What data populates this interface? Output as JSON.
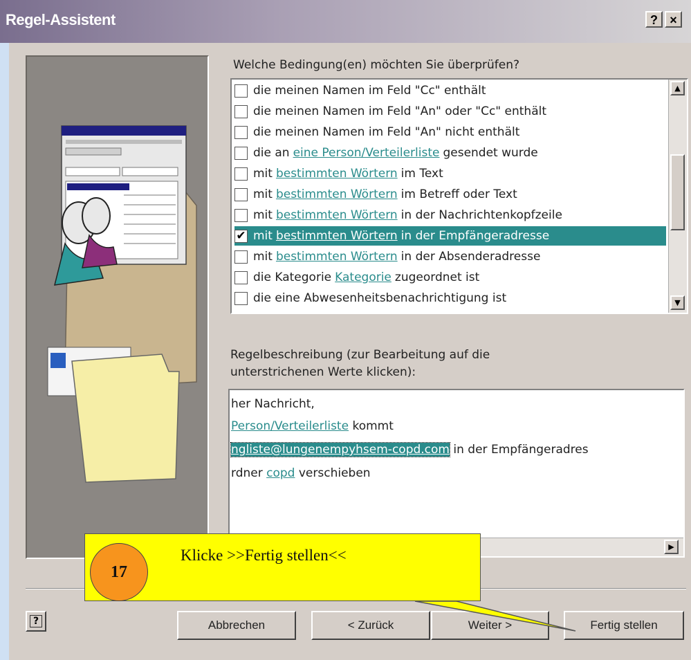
{
  "window": {
    "title": "Regel-Assistent",
    "help_btn": "?",
    "close_btn": "×"
  },
  "conditions": {
    "heading": "Welche Bedingung(en) möchten Sie überprüfen?",
    "items": [
      {
        "checked": false,
        "before": "die meinen Namen im Feld \"Cc\" enthält",
        "link": "",
        "after": ""
      },
      {
        "checked": false,
        "before": "die meinen Namen im Feld \"An\" oder \"Cc\" enthält",
        "link": "",
        "after": ""
      },
      {
        "checked": false,
        "before": "die meinen Namen im Feld \"An\" nicht enthält",
        "link": "",
        "after": ""
      },
      {
        "checked": false,
        "before": "die an",
        "link": "eine Person/Verteilerliste",
        "after": "gesendet wurde"
      },
      {
        "checked": false,
        "before": "mit",
        "link": "bestimmten Wörtern",
        "after": "im Text"
      },
      {
        "checked": false,
        "before": "mit",
        "link": "bestimmten Wörtern",
        "after": "im Betreff oder Text"
      },
      {
        "checked": false,
        "before": "mit",
        "link": "bestimmten Wörtern",
        "after": "in der Nachrichtenkopfzeile"
      },
      {
        "checked": true,
        "before": "mit",
        "link": "bestimmten Wörtern",
        "after": "in der Empfängeradresse"
      },
      {
        "checked": false,
        "before": "mit",
        "link": "bestimmten Wörtern",
        "after": "in der Absenderadresse"
      },
      {
        "checked": false,
        "before": "die Kategorie",
        "link": "Kategorie",
        "after": "zugeordnet ist"
      },
      {
        "checked": false,
        "before": "die eine Abwesenheitsbenachrichtigung ist",
        "link": "",
        "after": ""
      }
    ]
  },
  "description": {
    "heading_line1": "Regelbeschreibung (zur Bearbeitung auf die",
    "heading_line2": "unterstrichenen Werte klicken):",
    "line1": "her Nachricht,",
    "line2_link": "Person/Verteilerliste",
    "line2_after": " kommt",
    "line3_link": "ngliste@lungenempyhsem-copd.com",
    "line3_after": " in der Empfängeradres",
    "line4_before": "rdner ",
    "line4_link": "copd",
    "line4_after": " verschieben"
  },
  "buttons": {
    "cancel": "Abbrechen",
    "back": "< Zurück",
    "next": "Weiter >",
    "finish": "Fertig stellen",
    "help": "?"
  },
  "callout": {
    "step": "17",
    "text": "Klicke >>Fertig stellen<<"
  },
  "colors": {
    "selection": "#2a8c8c",
    "callout": "#ffff00",
    "badge": "#f7941d"
  }
}
